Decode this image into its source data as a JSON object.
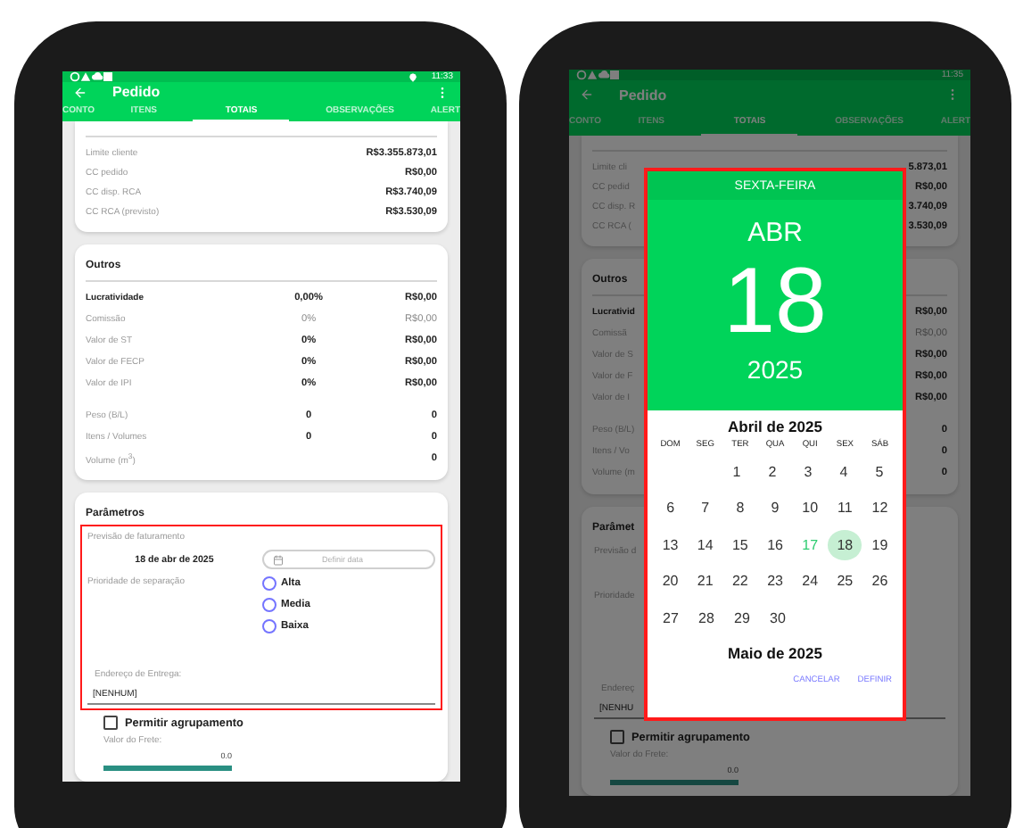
{
  "phones": [
    {
      "status": {
        "time": "11:33",
        "location_icon": true
      },
      "title": "Pedido",
      "tabs": [
        {
          "label": "CONTO",
          "selected": false
        },
        {
          "label": "ITENS",
          "selected": false
        },
        {
          "label": "TOTAIS",
          "selected": true
        },
        {
          "label": "OBSERVAÇÕES",
          "selected": false
        },
        {
          "label": "ALERT",
          "selected": false
        }
      ],
      "summary": [
        {
          "label": "Limite cliente",
          "value": "R$3.355.873,01"
        },
        {
          "label": "CC pedido",
          "value": "R$0,00"
        },
        {
          "label": "CC disp. RCA",
          "value": "R$3.740,09"
        },
        {
          "label": "CC RCA (previsto)",
          "value": "R$3.530,09"
        }
      ],
      "others": {
        "title": "Outros",
        "rows": [
          {
            "kind": "strong",
            "label": "Lucratividade",
            "percent": "0,00%",
            "value": "R$0,00"
          },
          {
            "kind": "muted",
            "label": "Comissão",
            "percent": "0%",
            "value": "R$0,00"
          },
          {
            "kind": "normal",
            "label": "Valor de ST",
            "percent": "0%",
            "value": "R$0,00"
          },
          {
            "kind": "normal",
            "label": "Valor de FECP",
            "percent": "0%",
            "value": "R$0,00"
          },
          {
            "kind": "normal",
            "label": "Valor de IPI",
            "percent": "0%",
            "value": "R$0,00"
          }
        ],
        "measures": [
          {
            "label": "Peso (B/L)",
            "percent": "0",
            "value": "0"
          },
          {
            "label": "Itens / Volumes",
            "percent": "0",
            "value": "0"
          },
          {
            "label": "Volume (m$^{3}$)",
            "value": "0"
          }
        ]
      },
      "params": {
        "title": "Parâmetros",
        "highlight": true,
        "billing_label": "Previsão de faturamento",
        "billing_date": "18 de abr de 2025",
        "date_button": "Definir data",
        "priority_label": "Prioridade de separação",
        "priorities": [
          {
            "label": "Alta",
            "selected": false
          },
          {
            "label": "Media",
            "selected": false
          },
          {
            "label": "Baixa",
            "selected": false
          }
        ],
        "address_label": "Endereço de Entrega:",
        "address": "[NENHUM]",
        "grouping": {
          "label": "Permitir agrupamento",
          "checked": false
        },
        "freight_label": "Valor do Frete:",
        "freight_value": "0.0"
      }
    },
    {
      "status": {
        "time": "11:35",
        "location_icon": false
      },
      "title": "Pedido",
      "tabs": [
        {
          "label": "CONTO",
          "selected": false
        },
        {
          "label": "ITENS",
          "selected": false
        },
        {
          "label": "TOTAIS",
          "selected": true
        },
        {
          "label": "OBSERVAÇÕES",
          "selected": false
        },
        {
          "label": "ALERT",
          "selected": false
        }
      ],
      "summary": [
        {
          "label": "Limite cli",
          "value": "5.873,01"
        },
        {
          "label": "CC pedid",
          "value": "R$0,00"
        },
        {
          "label": "CC disp. R",
          "value": "3.740,09"
        },
        {
          "label": "CC RCA (",
          "value": "3.530,09"
        }
      ],
      "others": {
        "title": "Outros",
        "rows": [
          {
            "kind": "strong",
            "label": "Lucrativid",
            "value": "R$0,00"
          },
          {
            "kind": "muted",
            "label": "Comissã",
            "value": "R$0,00"
          },
          {
            "kind": "normal",
            "label": "Valor de S",
            "value": "R$0,00"
          },
          {
            "kind": "normal",
            "label": "Valor de F",
            "value": "R$0,00"
          },
          {
            "kind": "normal",
            "label": "Valor de I",
            "value": "R$0,00"
          }
        ],
        "measures": [
          {
            "label": "Peso (B/L)",
            "value": "0"
          },
          {
            "label": "Itens / Vo",
            "value": "0"
          },
          {
            "label": "Volume (m",
            "value": "0"
          }
        ]
      },
      "params": {
        "title": "Parâmet",
        "highlight": false,
        "billing_label": "Previsão d",
        "priority_label": "Prioridade",
        "address_label": "Endereç",
        "address": "[NENHU",
        "grouping": {
          "label": "Permitir agrupamento",
          "checked": false
        },
        "freight_label": "Valor do Frete:",
        "freight_value": "0.0"
      },
      "dialog": {
        "highlight": true,
        "weekday": "SEXTA-FEIRA",
        "month": "ABR",
        "day": "18",
        "year": "2025",
        "calendar_title": "Abril de 2025",
        "weekday_headers": [
          "DOM",
          "SEG",
          "TER",
          "QUA",
          "QUI",
          "SEX",
          "SÁB"
        ],
        "weeks": [
          {
            "days": [
              {
                "label": "1",
                "today": false,
                "selected": false
              },
              {
                "label": "2",
                "today": false,
                "selected": false
              },
              {
                "label": "3",
                "today": false,
                "selected": false
              },
              {
                "label": "4",
                "today": false,
                "selected": false
              },
              {
                "label": "5",
                "today": false,
                "selected": false
              }
            ]
          },
          {
            "days": [
              {
                "label": "6",
                "today": false,
                "selected": false
              },
              {
                "label": "7",
                "today": false,
                "selected": false
              },
              {
                "label": "8",
                "today": false,
                "selected": false
              },
              {
                "label": "9",
                "today": false,
                "selected": false
              },
              {
                "label": "10",
                "today": false,
                "selected": false
              },
              {
                "label": "11",
                "today": false,
                "selected": false
              },
              {
                "label": "12",
                "today": false,
                "selected": false
              }
            ]
          },
          {
            "days": [
              {
                "label": "13",
                "today": false,
                "selected": false
              },
              {
                "label": "14",
                "today": false,
                "selected": false
              },
              {
                "label": "15",
                "today": false,
                "selected": false
              },
              {
                "label": "16",
                "today": false,
                "selected": false
              },
              {
                "label": "17",
                "today": true,
                "selected": false
              },
              {
                "label": "18",
                "today": false,
                "selected": true
              },
              {
                "label": "19",
                "today": false,
                "selected": false
              }
            ]
          },
          {
            "days": [
              {
                "label": "20",
                "today": false,
                "selected": false
              },
              {
                "label": "21",
                "today": false,
                "selected": false
              },
              {
                "label": "22",
                "today": false,
                "selected": false
              },
              {
                "label": "23",
                "today": false,
                "selected": false
              },
              {
                "label": "24",
                "today": false,
                "selected": false
              },
              {
                "label": "25",
                "today": false,
                "selected": false
              },
              {
                "label": "26",
                "today": false,
                "selected": false
              }
            ]
          },
          {
            "days": [
              {
                "label": "27",
                "today": false,
                "selected": false
              },
              {
                "label": "28",
                "today": false,
                "selected": false
              },
              {
                "label": "29",
                "today": false,
                "selected": false
              },
              {
                "label": "30",
                "today": false,
                "selected": false
              }
            ]
          }
        ],
        "next_month_title": "Maio de 2025",
        "buttons": [
          "CANCELAR",
          "DEFINIR"
        ]
      }
    }
  ]
}
